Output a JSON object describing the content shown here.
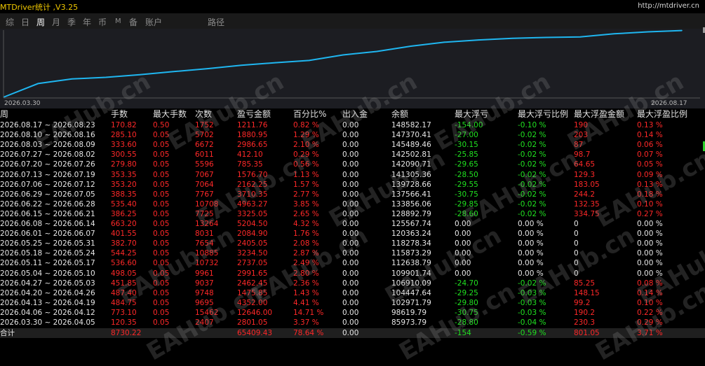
{
  "app": {
    "title": "MTDriver统计 ,V3.25",
    "link": "http://mtdriver.cn"
  },
  "tabs": [
    "综",
    "日",
    "周",
    "月",
    "季",
    "年",
    "币",
    "M",
    "备",
    "账户",
    "路径"
  ],
  "active_tab": "周",
  "chart": {
    "start_label": "2026.03.30",
    "end_label": "2026.08.17",
    "line_color": "#1fb6f0",
    "balance_values": [
      85973.79,
      98619.79,
      102971.79,
      104447.64,
      106910.09,
      109901.74,
      112638.79,
      115873.29,
      118278.34,
      120363.24,
      125567.74,
      128892.79,
      133856.06,
      137566.41,
      139728.66,
      141305.36,
      142090.71,
      142502.81,
      145489.46,
      147370.41,
      148582.17
    ]
  },
  "table": {
    "headers": [
      "周",
      "手数",
      "最大手数",
      "次数",
      "盈亏金额",
      "百分比%",
      "出入金",
      "余额",
      "最大浮亏",
      "最大浮亏比例",
      "最大浮盈金额",
      "最大浮盈比例"
    ],
    "rows": [
      [
        "2026.08.17 ~ 2026.08.23",
        "170.82",
        "0.50",
        "1752",
        "1211.76",
        "0.82 %",
        "0.00",
        "148582.17",
        "-154.00",
        "-0.10 %",
        "190",
        "0.13 %"
      ],
      [
        "2026.08.10 ~ 2026.08.16",
        "285.10",
        "0.05",
        "5702",
        "1880.95",
        "1.29 %",
        "0.00",
        "147370.41",
        "-27.00",
        "-0.02 %",
        "203",
        "0.14 %"
      ],
      [
        "2026.08.03 ~ 2026.08.09",
        "333.60",
        "0.05",
        "6672",
        "2986.65",
        "2.10 %",
        "0.00",
        "145489.46",
        "-30.15",
        "-0.02 %",
        "87",
        "0.06 %"
      ],
      [
        "2026.07.27 ~ 2026.08.02",
        "300.55",
        "0.05",
        "6011",
        "412.10",
        "0.29 %",
        "0.00",
        "142502.81",
        "-25.85",
        "-0.02 %",
        "98.7",
        "0.07 %"
      ],
      [
        "2026.07.20 ~ 2026.07.26",
        "279.80",
        "0.05",
        "5596",
        "785.35",
        "0.56 %",
        "0.00",
        "142090.71",
        "-29.65",
        "-0.02 %",
        "64.65",
        "0.05 %"
      ],
      [
        "2026.07.13 ~ 2026.07.19",
        "353.35",
        "0.05",
        "7067",
        "1576.70",
        "1.13 %",
        "0.00",
        "141305.36",
        "-28.50",
        "-0.02 %",
        "129.3",
        "0.09 %"
      ],
      [
        "2026.07.06 ~ 2026.07.12",
        "353.20",
        "0.05",
        "7064",
        "2162.25",
        "1.57 %",
        "0.00",
        "139728.66",
        "-29.55",
        "-0.02 %",
        "183.05",
        "0.13 %"
      ],
      [
        "2026.06.29 ~ 2026.07.05",
        "388.35",
        "0.05",
        "7767",
        "3710.35",
        "2.77 %",
        "0.00",
        "137566.41",
        "-30.75",
        "-0.02 %",
        "244.2",
        "0.18 %"
      ],
      [
        "2026.06.22 ~ 2026.06.28",
        "535.40",
        "0.05",
        "10708",
        "4963.27",
        "3.85 %",
        "0.00",
        "133856.06",
        "-29.85",
        "-0.02 %",
        "132.35",
        "0.10 %"
      ],
      [
        "2026.06.15 ~ 2026.06.21",
        "386.25",
        "0.05",
        "7725",
        "3325.05",
        "2.65 %",
        "0.00",
        "128892.79",
        "-28.60",
        "-0.02 %",
        "334.75",
        "0.27 %"
      ],
      [
        "2026.06.08 ~ 2026.06.14",
        "663.20",
        "0.05",
        "13264",
        "5204.50",
        "4.32 %",
        "0.00",
        "125567.74",
        "0.00",
        "0.00 %",
        "0",
        "0.00 %"
      ],
      [
        "2026.06.01 ~ 2026.06.07",
        "401.55",
        "0.05",
        "8031",
        "2084.90",
        "1.76 %",
        "0.00",
        "120363.24",
        "0.00",
        "0.00 %",
        "0",
        "0.00 %"
      ],
      [
        "2026.05.25 ~ 2026.05.31",
        "382.70",
        "0.05",
        "7654",
        "2405.05",
        "2.08 %",
        "0.00",
        "118278.34",
        "0.00",
        "0.00 %",
        "0",
        "0.00 %"
      ],
      [
        "2026.05.18 ~ 2026.05.24",
        "544.25",
        "0.05",
        "10885",
        "3234.50",
        "2.87 %",
        "0.00",
        "115873.29",
        "0.00",
        "0.00 %",
        "0",
        "0.00 %"
      ],
      [
        "2026.05.11 ~ 2026.05.17",
        "536.60",
        "0.05",
        "10732",
        "2737.05",
        "2.49 %",
        "0.00",
        "112638.79",
        "0.00",
        "0.00 %",
        "0",
        "0.00 %"
      ],
      [
        "2026.05.04 ~ 2026.05.10",
        "498.05",
        "0.05",
        "9961",
        "2991.65",
        "2.80 %",
        "0.00",
        "109901.74",
        "0.00",
        "0.00 %",
        "0",
        "0.00 %"
      ],
      [
        "2026.04.27 ~ 2026.05.03",
        "451.85",
        "0.05",
        "9037",
        "2462.45",
        "2.36 %",
        "0.00",
        "106910.09",
        "-24.70",
        "-0.02 %",
        "85.25",
        "0.08 %"
      ],
      [
        "2026.04.20 ~ 2026.04.26",
        "487.40",
        "0.05",
        "9748",
        "1475.85",
        "1.43 %",
        "0.00",
        "104447.64",
        "-29.25",
        "-0.03 %",
        "148.15",
        "0.14 %"
      ],
      [
        "2026.04.13 ~ 2026.04.19",
        "484.75",
        "0.05",
        "9695",
        "4352.00",
        "4.41 %",
        "0.00",
        "102971.79",
        "-29.80",
        "-0.03 %",
        "99.2",
        "0.10 %"
      ],
      [
        "2026.04.06 ~ 2026.04.12",
        "773.10",
        "0.05",
        "15462",
        "12646.00",
        "14.71 %",
        "0.00",
        "98619.79",
        "-30.75",
        "-0.03 %",
        "190.2",
        "0.22 %"
      ],
      [
        "2026.03.30 ~ 2026.04.05",
        "120.35",
        "0.05",
        "2407",
        "2801.05",
        "3.37 %",
        "0.00",
        "85973.79",
        "-28.80",
        "-0.04 %",
        "230.3",
        "0.29 %"
      ]
    ],
    "total": [
      "合计",
      "8730.22",
      "",
      "",
      "65409.43",
      "78.64 %",
      "0.00",
      "",
      "-154",
      "-0.59 %",
      "801.05",
      "3.71 %"
    ]
  },
  "colors": {
    "positive": "#ff2828",
    "negative": "#20e020",
    "neutral": "#e6e6e6",
    "accent": "#f0c800"
  },
  "watermark": "EAHub.cn"
}
